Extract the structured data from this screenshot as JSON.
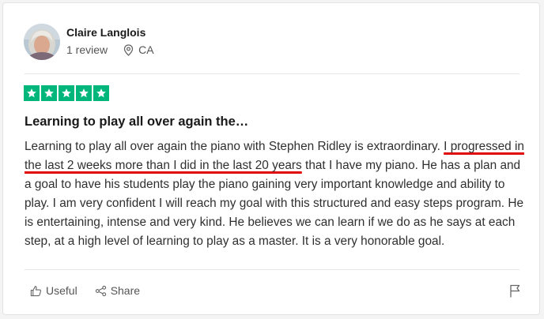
{
  "reviewer": {
    "name": "Claire Langlois",
    "review_count": "1 review",
    "location": "CA"
  },
  "review": {
    "rating": 5,
    "rating_max": 5,
    "star_color": "#00b67a",
    "title": "Learning to play all over again the…",
    "body_before": "Learning to play all over again the piano with Stephen Ridley is extraordinary. ",
    "body_highlight": "I progressed in the last 2 weeks more than I did in the last 20 years",
    "body_after": " that I have my piano. He has a plan and a goal to have his students play the piano gaining very important knowledge and ability to play. I am very confident I will reach my goal with this structured and easy steps program. He is entertaining, intense and very kind. He believes we can learn if we do as he says at each step, at a high level of learning to play as a master. It is a very honorable goal.",
    "highlight_color": "#e10a0a"
  },
  "actions": {
    "useful_label": "Useful",
    "share_label": "Share",
    "useful_icon": "thumbs-up-icon",
    "share_icon": "share-icon",
    "report_icon": "flag-icon"
  }
}
